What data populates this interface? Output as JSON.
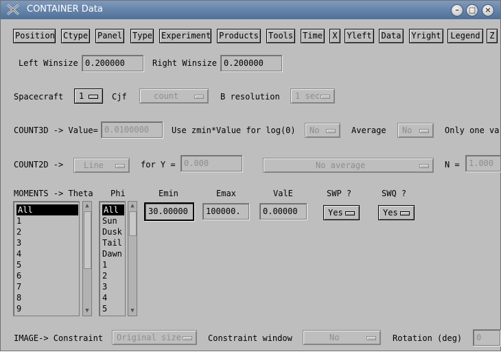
{
  "window": {
    "title": "CONTAINER Data"
  },
  "menu": [
    "Position",
    "Ctype",
    "Panel",
    "Type",
    "Experiment",
    "Products",
    "Tools",
    "Time",
    "X",
    "Yleft",
    "Data",
    "Yright",
    "Legend",
    "Z"
  ],
  "winsize": {
    "left_label": "Left Winsize",
    "left_value": "0.200000",
    "right_label": "Right Winsize",
    "right_value": "0.200000"
  },
  "spacecraft": {
    "label": "Spacecraft",
    "value": "1",
    "cjf_label": "Cjf",
    "cjf_value": "count",
    "bres_label": "B resolution",
    "bres_value": "1 sec"
  },
  "count3d": {
    "label": "COUNT3D -> Value=",
    "value": "0.0100000",
    "zmin_label": "Use zmin*Value for log(0)",
    "zmin_value": "No",
    "avg_label": "Average",
    "avg_value": "No",
    "only_label": "Only one va"
  },
  "count2d": {
    "label": "COUNT2D ->",
    "mode": "Line",
    "fory_label": "for Y =",
    "fory_value": "0.000",
    "avg_value": "No average",
    "n_label": "N =",
    "n_value": "1.000"
  },
  "moments": {
    "theta_label": "MOMENTS -> Theta",
    "theta_items": [
      "All",
      "1",
      "2",
      "3",
      "4",
      "5",
      "6",
      "7",
      "8",
      "9"
    ],
    "phi_label": "Phi",
    "phi_items": [
      "All",
      "Sun",
      "Dusk",
      "Tail",
      "Dawn",
      "1",
      "2",
      "3",
      "4",
      "5"
    ],
    "emin_label": "Emin",
    "emin_value": "30.00000",
    "emax_label": "Emax",
    "emax_value": "100000.",
    "vale_label": "ValE",
    "vale_value": "0.00000",
    "swp_label": "SWP ?",
    "swp_value": "Yes",
    "swq_label": "SWQ ?",
    "swq_value": "Yes"
  },
  "image": {
    "label": "IMAGE-> Constraint",
    "constraint_value": "Original size",
    "cwin_label": "Constraint window",
    "cwin_value": "No",
    "rot_label": "Rotation (deg)",
    "rot_value": "0"
  }
}
